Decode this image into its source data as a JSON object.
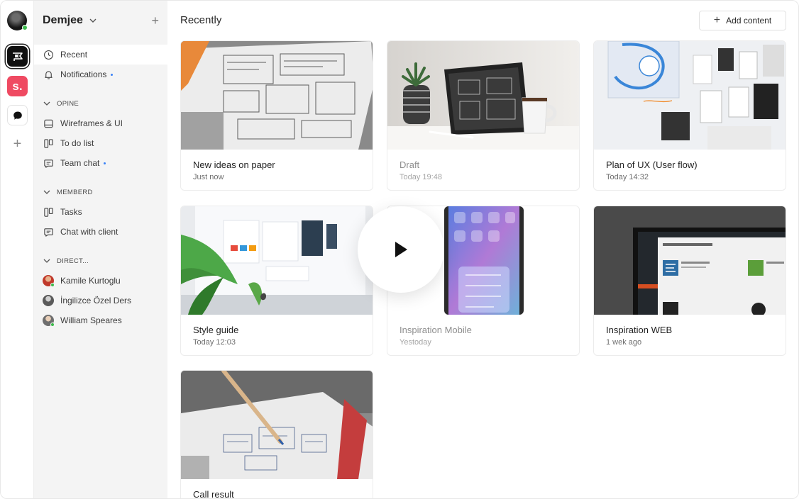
{
  "workspace": {
    "name": "Demjee"
  },
  "rail": {
    "workspaces": [
      {
        "name": "opine",
        "icon": "flag-icon"
      },
      {
        "name": "s",
        "letter": "s."
      },
      {
        "name": "chat",
        "icon": "chat-bubble-icon"
      }
    ]
  },
  "nav": {
    "recent": "Recent",
    "notifications": "Notifications"
  },
  "sections": [
    {
      "title": "OPINE",
      "items": [
        {
          "label": "Wireframes & UI",
          "icon": "board-icon"
        },
        {
          "label": "To do list",
          "icon": "kanban-icon"
        },
        {
          "label": "Team chat",
          "icon": "message-icon",
          "dot": true
        }
      ]
    },
    {
      "title": "MEMBERD",
      "items": [
        {
          "label": "Tasks",
          "icon": "kanban-icon"
        },
        {
          "label": "Chat with client",
          "icon": "message-icon"
        }
      ]
    },
    {
      "title": "DIRECT...",
      "items": [
        {
          "label": "Kamile Kurtoglu",
          "icon": "avatar"
        },
        {
          "label": "İngilizce Özel Ders",
          "icon": "avatar"
        },
        {
          "label": "William Speares",
          "icon": "avatar"
        }
      ]
    }
  ],
  "main": {
    "title": "Recently",
    "add_label": "Add content"
  },
  "cards": [
    {
      "title": "New ideas on paper",
      "time": "Just now"
    },
    {
      "title": "Draft",
      "time": "Today 19:48"
    },
    {
      "title": "Plan of UX (User flow)",
      "time": "Today 14:32"
    },
    {
      "title": "Style guide",
      "time": "Today 12:03"
    },
    {
      "title": "Inspiration Mobile",
      "time": "Yestoday"
    },
    {
      "title": "Inspiration WEB",
      "time": "1 wek ago"
    },
    {
      "title": "Call result",
      "time": ""
    }
  ],
  "colors": {
    "accent": "#3b82f6",
    "online": "#3dbb4d",
    "brand_s": "#ef4a62"
  }
}
